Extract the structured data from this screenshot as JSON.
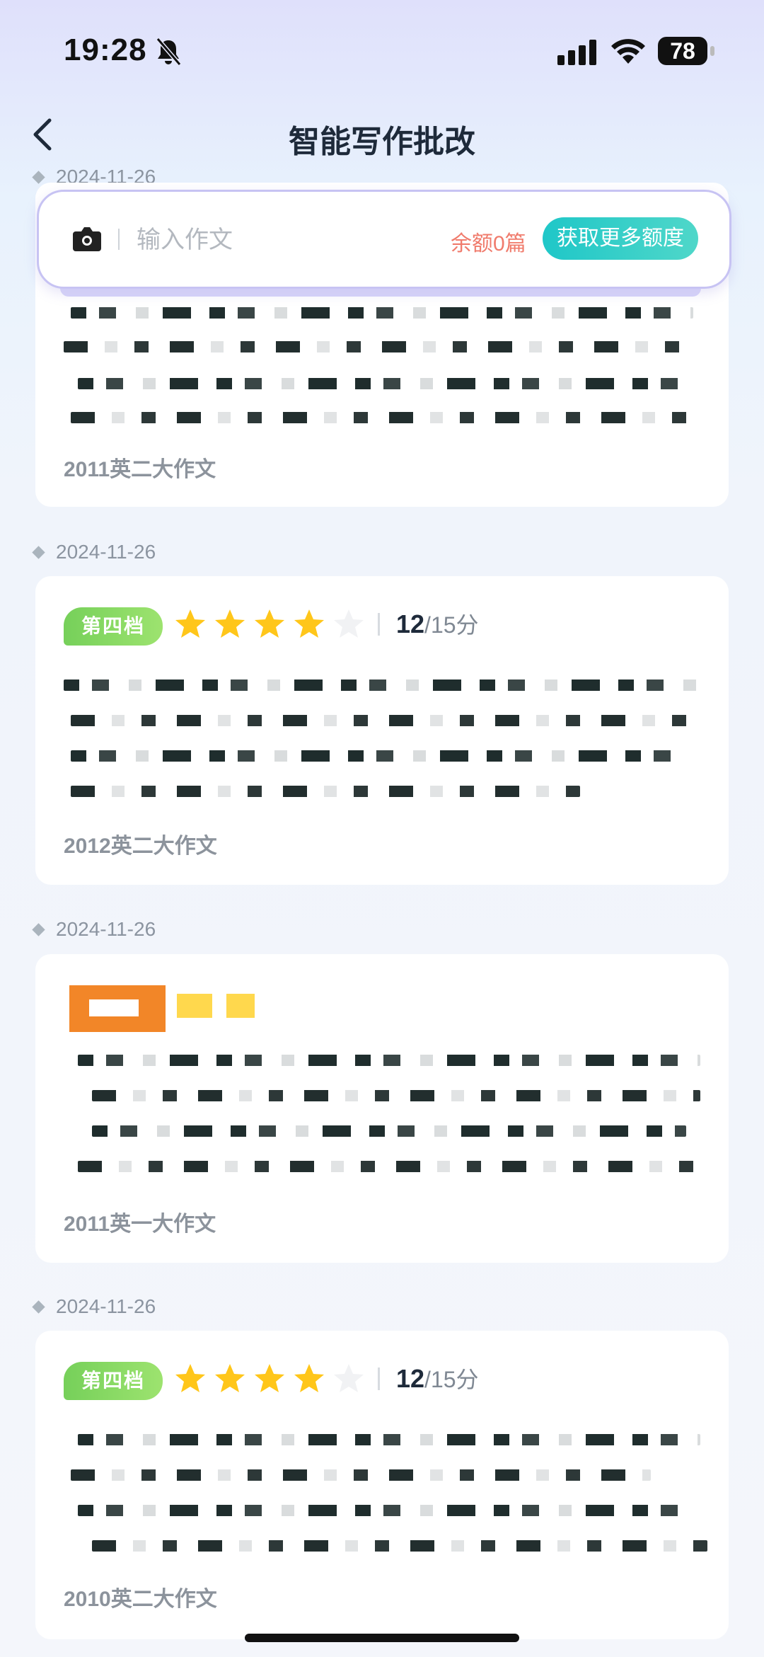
{
  "status_bar": {
    "time": "19:28",
    "battery": "78"
  },
  "nav": {
    "title": "智能写作批改"
  },
  "search": {
    "placeholder": "输入作文",
    "quota": "余额0篇",
    "get_more": "获取更多额度"
  },
  "records": [
    {
      "date": "2024-11-26",
      "exam": "2011英二大作文"
    },
    {
      "date": "2024-11-26",
      "level": "第四档",
      "stars": 4,
      "max_stars": 5,
      "score": "12",
      "score_total": "/15分",
      "exam": "2012英二大作文"
    },
    {
      "date": "2024-11-26",
      "exam": "2011英一大作文"
    },
    {
      "date": "2024-11-26",
      "level": "第四档",
      "stars": 4,
      "max_stars": 5,
      "score": "12",
      "score_total": "/15分",
      "exam": "2010英二大作文"
    }
  ],
  "colors": {
    "accent": "#1fc7c8",
    "quota": "#f07b6c",
    "badge_green": "#76d05a",
    "star": "#ffc61a"
  }
}
